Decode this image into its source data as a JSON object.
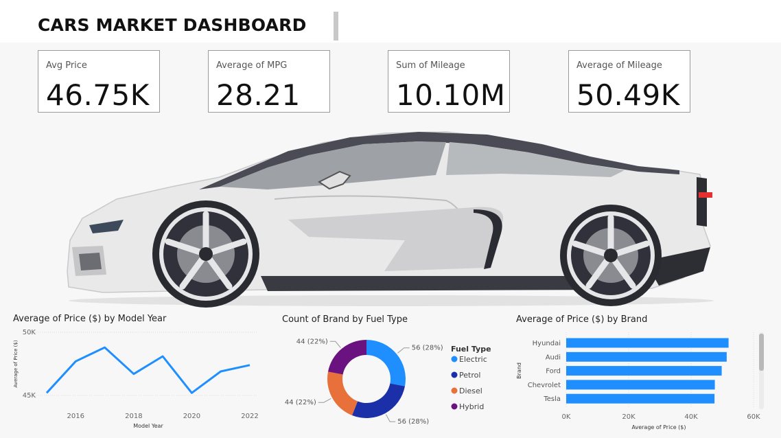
{
  "dashboard": {
    "title": "CARS MARKET DASHBOARD"
  },
  "kpis": [
    {
      "label": "Avg Price",
      "value": "46.75K"
    },
    {
      "label": "Average of MPG",
      "value": "28.21"
    },
    {
      "label": "Sum of Mileage",
      "value": "10.10M"
    },
    {
      "label": "Average of Mileage",
      "value": "50.49K"
    }
  ],
  "colors": {
    "line": "#1f8fff",
    "bar": "#1f8fff",
    "electric": "#1f8fff",
    "petrol": "#1a2fa8",
    "diesel": "#e8703a",
    "hybrid": "#6a1380"
  },
  "chart_data": [
    {
      "type": "line",
      "title": "Average of Price ($) by Model Year",
      "xlabel": "Model Year",
      "ylabel": "Average of Price ($)",
      "x": [
        2015,
        2016,
        2017,
        2018,
        2019,
        2020,
        2021,
        2022
      ],
      "xticks": [
        "2016",
        "2018",
        "2020",
        "2022"
      ],
      "yticks": [
        "50K",
        "45K"
      ],
      "values": [
        45200,
        47700,
        48800,
        46700,
        48100,
        45200,
        46900,
        47400
      ],
      "xlim": [
        2015,
        2022
      ],
      "ylim": [
        45000,
        50000
      ]
    },
    {
      "type": "pie",
      "title": "Count of Brand by Fuel Type",
      "legend_title": "Fuel Type",
      "legend_position": "right",
      "slices": [
        {
          "name": "Electric",
          "value": 56,
          "label": "56 (28%)"
        },
        {
          "name": "Petrol",
          "value": 56,
          "label": "56 (28%)"
        },
        {
          "name": "Diesel",
          "value": 44,
          "label": "44 (22%)"
        },
        {
          "name": "Hybrid",
          "value": 44,
          "label": "44 (22%)"
        }
      ]
    },
    {
      "type": "bar",
      "orientation": "horizontal",
      "title": "Average of Price ($) by Brand",
      "xlabel": "Average of Price ($)",
      "ylabel": "Brand",
      "categories": [
        "Hyundai",
        "Audi",
        "Ford",
        "Chevrolet",
        "Tesla"
      ],
      "values": [
        52000,
        51400,
        49800,
        47600,
        47500
      ],
      "xticks": [
        "0K",
        "20K",
        "40K",
        "60K"
      ],
      "xlim": [
        0,
        60000
      ]
    }
  ]
}
